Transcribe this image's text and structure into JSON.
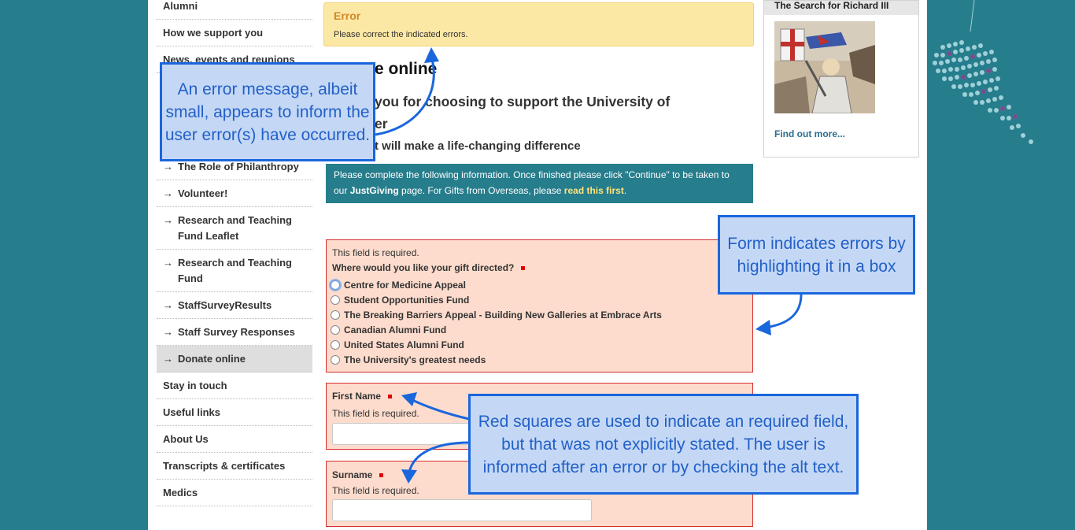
{
  "sidebar": {
    "items": [
      {
        "label": "Alumni",
        "sub": false
      },
      {
        "label": "How we support you",
        "sub": false
      },
      {
        "label": "News, events and reunions",
        "sub": false
      },
      {
        "label": "The Role of Philanthropy",
        "sub": true
      },
      {
        "label": "Volunteer!",
        "sub": true
      },
      {
        "label": "Research and Teaching Fund Leaflet",
        "sub": true
      },
      {
        "label": "Research and Teaching Fund",
        "sub": true
      },
      {
        "label": "StaffSurveyResults",
        "sub": true
      },
      {
        "label": "Staff Survey Responses",
        "sub": true
      },
      {
        "label": "Donate online",
        "sub": true,
        "active": true
      },
      {
        "label": "Stay in touch",
        "sub": false
      },
      {
        "label": "Useful links",
        "sub": false
      },
      {
        "label": "About Us",
        "sub": false
      },
      {
        "label": "Transcripts & certificates",
        "sub": false
      },
      {
        "label": "Medics",
        "sub": false
      }
    ]
  },
  "error": {
    "title": "Error",
    "message": "Please correct the indicated errors."
  },
  "main": {
    "heading": "e online",
    "subheading_line1": "you for choosing to support the University of",
    "subheading_line2": "er",
    "tagline": "t will make a life-changing difference",
    "info_part1": "Please complete the following information. Once finished please click \"Continue\" to be taken to our ",
    "info_bold": "JustGiving",
    "info_part2": " page.  For Gifts from Overseas, please ",
    "info_link": "read this first",
    "info_end": "."
  },
  "form": {
    "required_msg": "This field is required.",
    "gift_question": "Where would you like your gift directed?",
    "gift_options": [
      "Centre for Medicine Appeal",
      "Student Opportunities Fund",
      "The Breaking Barriers Appeal - Building New Galleries at Embrace Arts",
      "Canadian Alumni Fund",
      "United States Alumni Fund",
      "The University's greatest needs"
    ],
    "first_name_label": "First Name",
    "surname_label": "Surname",
    "first_name_value": "",
    "surname_value": ""
  },
  "promo": {
    "title": "The Search for Richard III",
    "link": "Find out more..."
  },
  "annotations": {
    "error_note": "An error message, albeit small, appears to inform the user error(s) have occurred.",
    "box_note": "Form indicates errors by highlighting it in a box",
    "required_note": "Red squares are used to indicate an required field, but that was not explicitly stated. The user is informed after an error or by checking the alt text."
  },
  "colors": {
    "background": "#267d8c",
    "error_bg": "#fce8a5",
    "error_title": "#d0892a",
    "field_error_bg": "#fddccd",
    "field_error_border": "#d32d2d",
    "required_marker": "#e00000",
    "callout_bg": "#c4d8f5",
    "callout_border": "#1a66dc"
  }
}
